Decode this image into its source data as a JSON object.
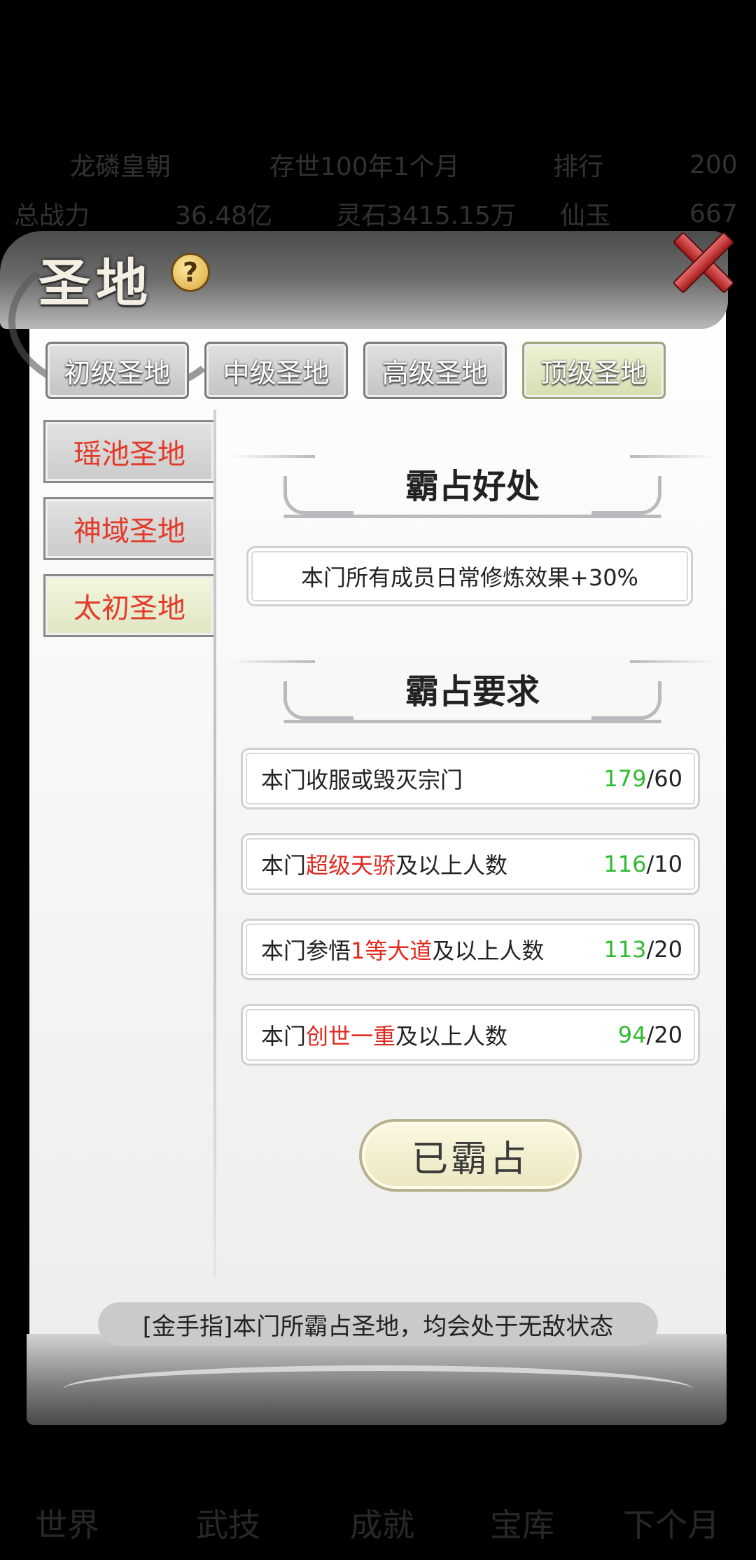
{
  "background": {
    "row1": [
      "龙磷皇朝",
      "存世100年1个月",
      "排行",
      "200"
    ],
    "row2": [
      "总战力",
      "36.48亿",
      "灵石3415.15万",
      "仙玉",
      "667"
    ],
    "bottom_nav": [
      "世界",
      "武技",
      "成就",
      "宝库",
      "下个月"
    ]
  },
  "dialog": {
    "title": "圣地",
    "help_icon": "question-icon",
    "close_icon": "close-icon"
  },
  "tabs": [
    "初级圣地",
    "中级圣地",
    "高级圣地",
    "顶级圣地"
  ],
  "active_tab": "顶级圣地",
  "sidebar": [
    "瑶池圣地",
    "神域圣地",
    "太初圣地"
  ],
  "active_sidebar": "太初圣地",
  "benefit": {
    "heading": "霸占好处",
    "text": "本门所有成员日常修炼效果+30%"
  },
  "requirements": {
    "heading": "霸占要求",
    "items": [
      {
        "pre": "本门收服或毁灭宗门",
        "highlight": "",
        "post": "",
        "current": "179",
        "required": "/60"
      },
      {
        "pre": "本门",
        "highlight": "超级天骄",
        "post": "及以上人数",
        "current": "116",
        "required": "/10"
      },
      {
        "pre": "本门参悟",
        "highlight": "1等大道",
        "post": "及以上人数",
        "current": "113",
        "required": "/20"
      },
      {
        "pre": "本门",
        "highlight": "创世一重",
        "post": "及以上人数",
        "current": "94",
        "required": "/20"
      }
    ]
  },
  "action_button": "已霸占",
  "tip": "[金手指]本门所霸占圣地，均会处于无敌状态",
  "colors": {
    "highlight_red": "#e02a1f",
    "progress_green": "#2fbb2f"
  }
}
